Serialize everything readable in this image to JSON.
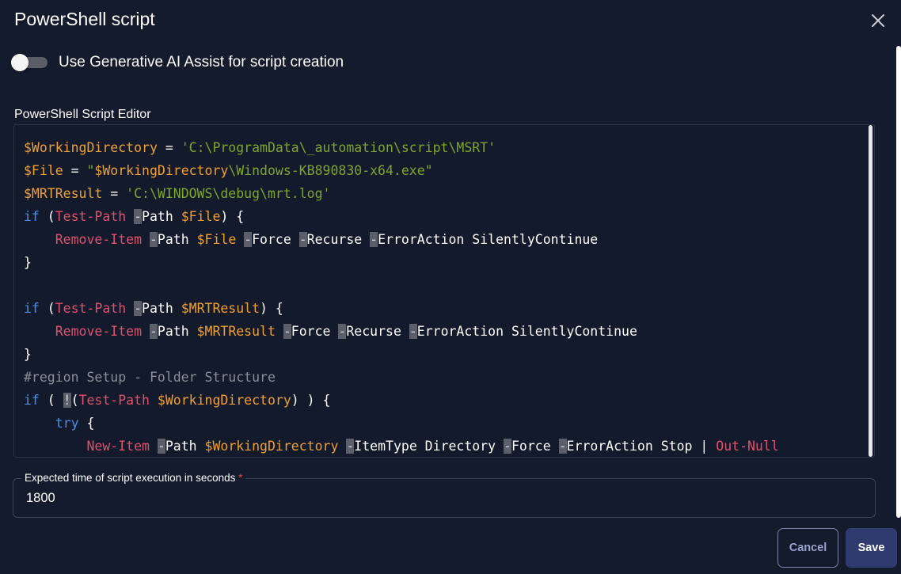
{
  "dialog": {
    "title": "PowerShell script",
    "close_icon": "close-icon"
  },
  "ai_toggle": {
    "label": "Use Generative AI Assist for script creation",
    "state": "off"
  },
  "editor": {
    "label": "PowerShell Script Editor",
    "colors": {
      "variable": "#f0a030",
      "string": "#7ea62a",
      "keyword": "#4b8de0",
      "cmdlet": "#e0506e",
      "comment": "#8a8f99",
      "text": "#ffffff"
    },
    "lines": [
      [
        [
          "var",
          "$WorkingDirectory"
        ],
        [
          "txt",
          " = "
        ],
        [
          "str",
          "'C:\\ProgramData\\_automation\\script\\MSRT'"
        ]
      ],
      [
        [
          "var",
          "$File"
        ],
        [
          "txt",
          " = "
        ],
        [
          "str",
          "\""
        ],
        [
          "var",
          "$WorkingDirectory"
        ],
        [
          "str",
          "\\Windows-KB890830-x64.exe\""
        ]
      ],
      [
        [
          "var",
          "$MRTResult"
        ],
        [
          "txt",
          " = "
        ],
        [
          "str",
          "'C:\\WINDOWS\\debug\\mrt.log'"
        ]
      ],
      [
        [
          "kw",
          "if"
        ],
        [
          "txt",
          " ("
        ],
        [
          "cmd",
          "Test-Path"
        ],
        [
          "txt",
          " "
        ],
        [
          "dash",
          "-"
        ],
        [
          "txt",
          "Path "
        ],
        [
          "var",
          "$File"
        ],
        [
          "txt",
          ") {"
        ]
      ],
      [
        [
          "txt",
          "    "
        ],
        [
          "cmd",
          "Remove-Item"
        ],
        [
          "txt",
          " "
        ],
        [
          "dash",
          "-"
        ],
        [
          "txt",
          "Path "
        ],
        [
          "var",
          "$File"
        ],
        [
          "txt",
          " "
        ],
        [
          "dash",
          "-"
        ],
        [
          "txt",
          "Force "
        ],
        [
          "dash",
          "-"
        ],
        [
          "txt",
          "Recurse "
        ],
        [
          "dash",
          "-"
        ],
        [
          "txt",
          "ErrorAction SilentlyContinue"
        ]
      ],
      [
        [
          "txt",
          "}"
        ]
      ],
      [
        [
          "txt",
          ""
        ]
      ],
      [
        [
          "kw",
          "if"
        ],
        [
          "txt",
          " ("
        ],
        [
          "cmd",
          "Test-Path"
        ],
        [
          "txt",
          " "
        ],
        [
          "dash",
          "-"
        ],
        [
          "txt",
          "Path "
        ],
        [
          "var",
          "$MRTResult"
        ],
        [
          "txt",
          ") {"
        ]
      ],
      [
        [
          "txt",
          "    "
        ],
        [
          "cmd",
          "Remove-Item"
        ],
        [
          "txt",
          " "
        ],
        [
          "dash",
          "-"
        ],
        [
          "txt",
          "Path "
        ],
        [
          "var",
          "$MRTResult"
        ],
        [
          "txt",
          " "
        ],
        [
          "dash",
          "-"
        ],
        [
          "txt",
          "Force "
        ],
        [
          "dash",
          "-"
        ],
        [
          "txt",
          "Recurse "
        ],
        [
          "dash",
          "-"
        ],
        [
          "txt",
          "ErrorAction SilentlyContinue"
        ]
      ],
      [
        [
          "txt",
          "}"
        ]
      ],
      [
        [
          "cmt",
          "#region Setup - Folder Structure"
        ]
      ],
      [
        [
          "kw",
          "if"
        ],
        [
          "txt",
          " ( "
        ],
        [
          "dash",
          "!"
        ],
        [
          "txt",
          "("
        ],
        [
          "cmd",
          "Test-Path"
        ],
        [
          "txt",
          " "
        ],
        [
          "var",
          "$WorkingDirectory"
        ],
        [
          "txt",
          ") ) {"
        ]
      ],
      [
        [
          "txt",
          "    "
        ],
        [
          "kw",
          "try"
        ],
        [
          "txt",
          " {"
        ]
      ],
      [
        [
          "txt",
          "        "
        ],
        [
          "cmd",
          "New-Item"
        ],
        [
          "txt",
          " "
        ],
        [
          "dash",
          "-"
        ],
        [
          "txt",
          "Path "
        ],
        [
          "var",
          "$WorkingDirectory"
        ],
        [
          "txt",
          " "
        ],
        [
          "dash",
          "-"
        ],
        [
          "txt",
          "ItemType Directory "
        ],
        [
          "dash",
          "-"
        ],
        [
          "txt",
          "Force "
        ],
        [
          "dash",
          "-"
        ],
        [
          "txt",
          "ErrorAction Stop | "
        ],
        [
          "cmd",
          "Out-Null"
        ]
      ]
    ]
  },
  "execution_time": {
    "label": "Expected time of script execution in seconds",
    "required_mark": "*",
    "value": "1800"
  },
  "buttons": {
    "cancel": "Cancel",
    "save": "Save"
  }
}
